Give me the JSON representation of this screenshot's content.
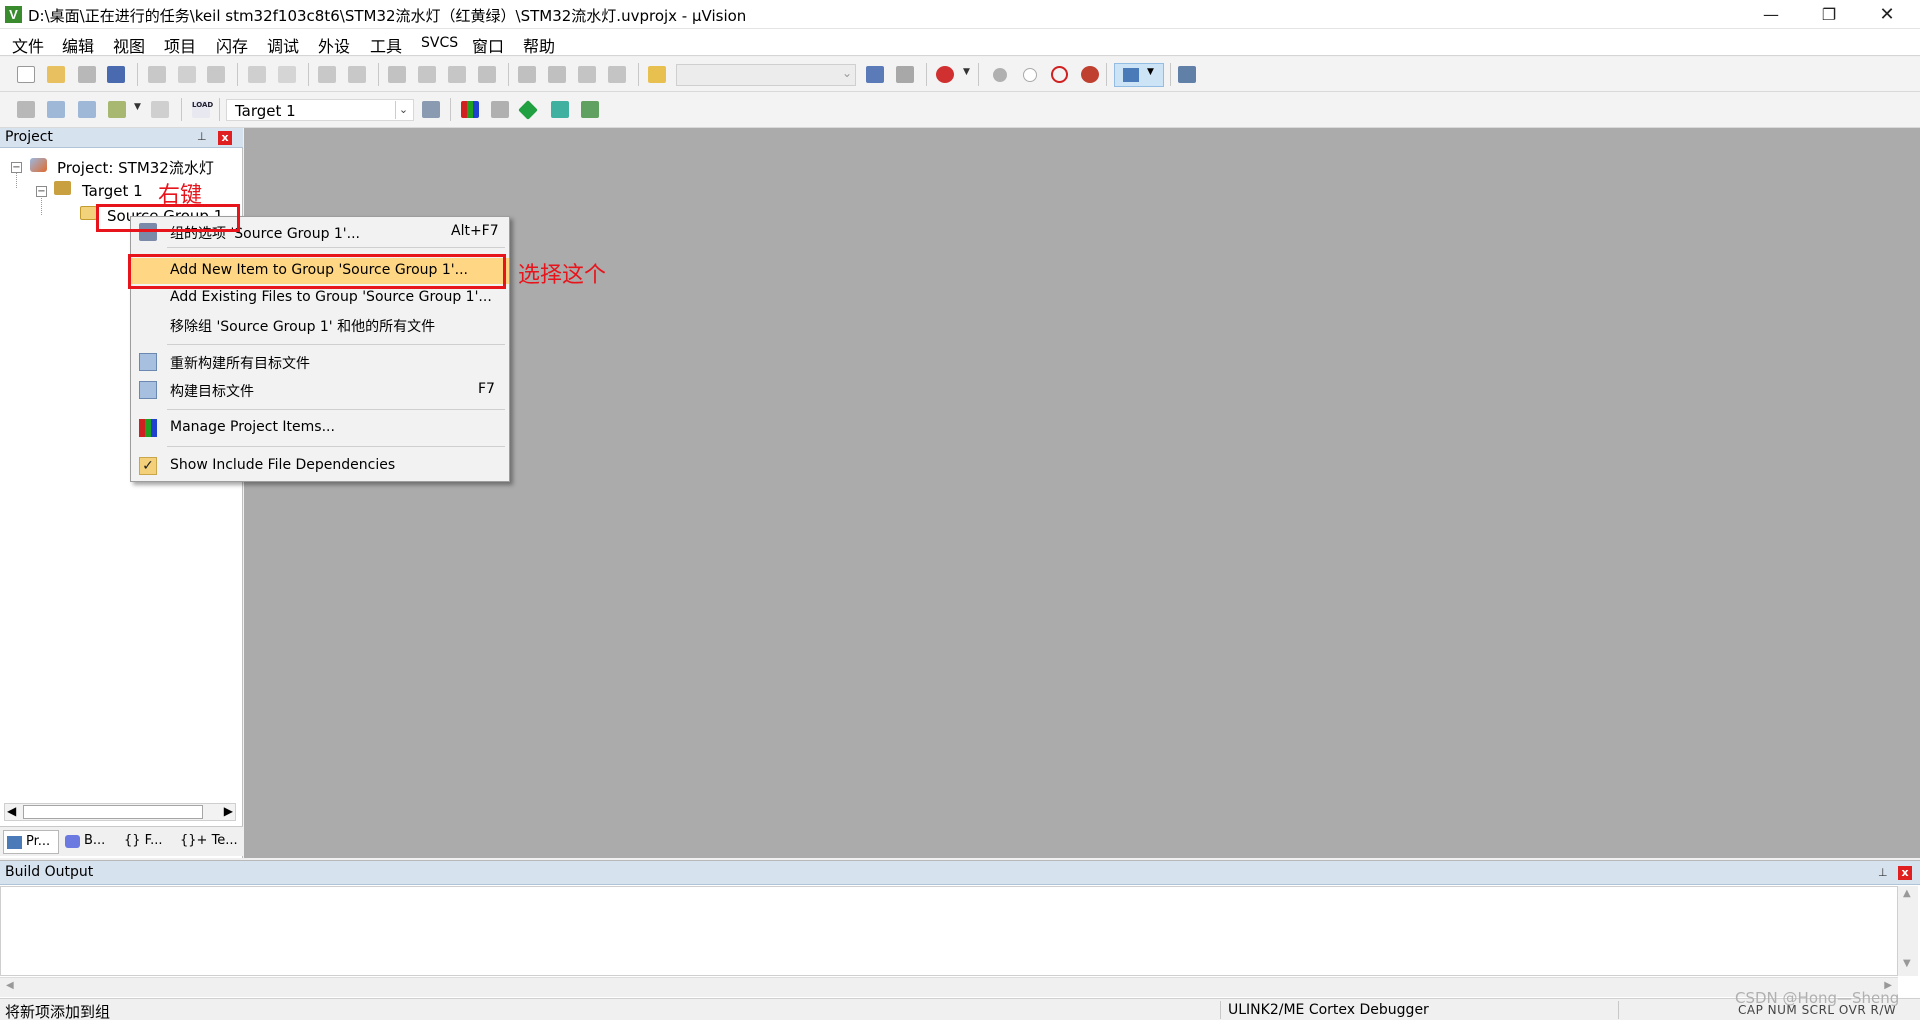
{
  "window": {
    "title": "D:\\桌面\\正在进行的任务\\keil stm32f103c8t6\\STM32流水灯（红黄绿）\\STM32流水灯.uvprojx - µVision",
    "app_icon": "V",
    "minimize": "—",
    "maximize": "❐",
    "close": "✕"
  },
  "menu": [
    "文件",
    "编辑",
    "视图",
    "项目",
    "闪存",
    "调试",
    "外设",
    "工具",
    "SVCS",
    "窗口",
    "帮助"
  ],
  "toolbar2": {
    "target": "Target 1",
    "load_label": "LOAD"
  },
  "project_panel": {
    "title": "Project",
    "pin": "📌",
    "close": "x",
    "tree": {
      "project": "Project: STM32流水灯",
      "target": "Target 1",
      "group": "Source Group 1"
    },
    "tabs": [
      "Pr...",
      "B...",
      "{} F...",
      "{}+ Te..."
    ]
  },
  "context_menu": {
    "items": [
      {
        "label": "组的选项 'Source Group 1'...",
        "shortcut": "Alt+F7",
        "icon": "options-wand-icon"
      },
      {
        "label": "Add New  Item to Group 'Source Group 1'...",
        "shortcut": "",
        "icon": ""
      },
      {
        "label": "Add Existing Files to Group 'Source Group 1'...",
        "shortcut": "",
        "icon": ""
      },
      {
        "label": "移除组 'Source Group 1' 和他的所有文件",
        "shortcut": "",
        "icon": ""
      },
      {
        "label": "重新构建所有目标文件",
        "shortcut": "",
        "icon": "rebuild-icon"
      },
      {
        "label": "构建目标文件",
        "shortcut": "F7",
        "icon": "build-icon"
      },
      {
        "label": "Manage Project Items...",
        "shortcut": "",
        "icon": "manage-items-icon"
      },
      {
        "label": "Show Include File Dependencies",
        "shortcut": "",
        "icon": "checkmark-icon"
      }
    ],
    "checkmark": "✓"
  },
  "annotations": {
    "right_click": "右键",
    "choose_this": "选择这个",
    "color": "#e8141c"
  },
  "build_output": {
    "title": "Build Output",
    "close": "x"
  },
  "status_bar": {
    "text": "将新项添加到组",
    "debugger": "ULINK2/ME Cortex Debugger",
    "indicators": "CAP  NUM  SCRL  OVR  R/W"
  },
  "watermark": "CSDN @Hong—Sheng",
  "colors": {
    "highlight": "#ffd784",
    "editor_bg": "#ababab",
    "panel_header": "#d6e2ee"
  }
}
